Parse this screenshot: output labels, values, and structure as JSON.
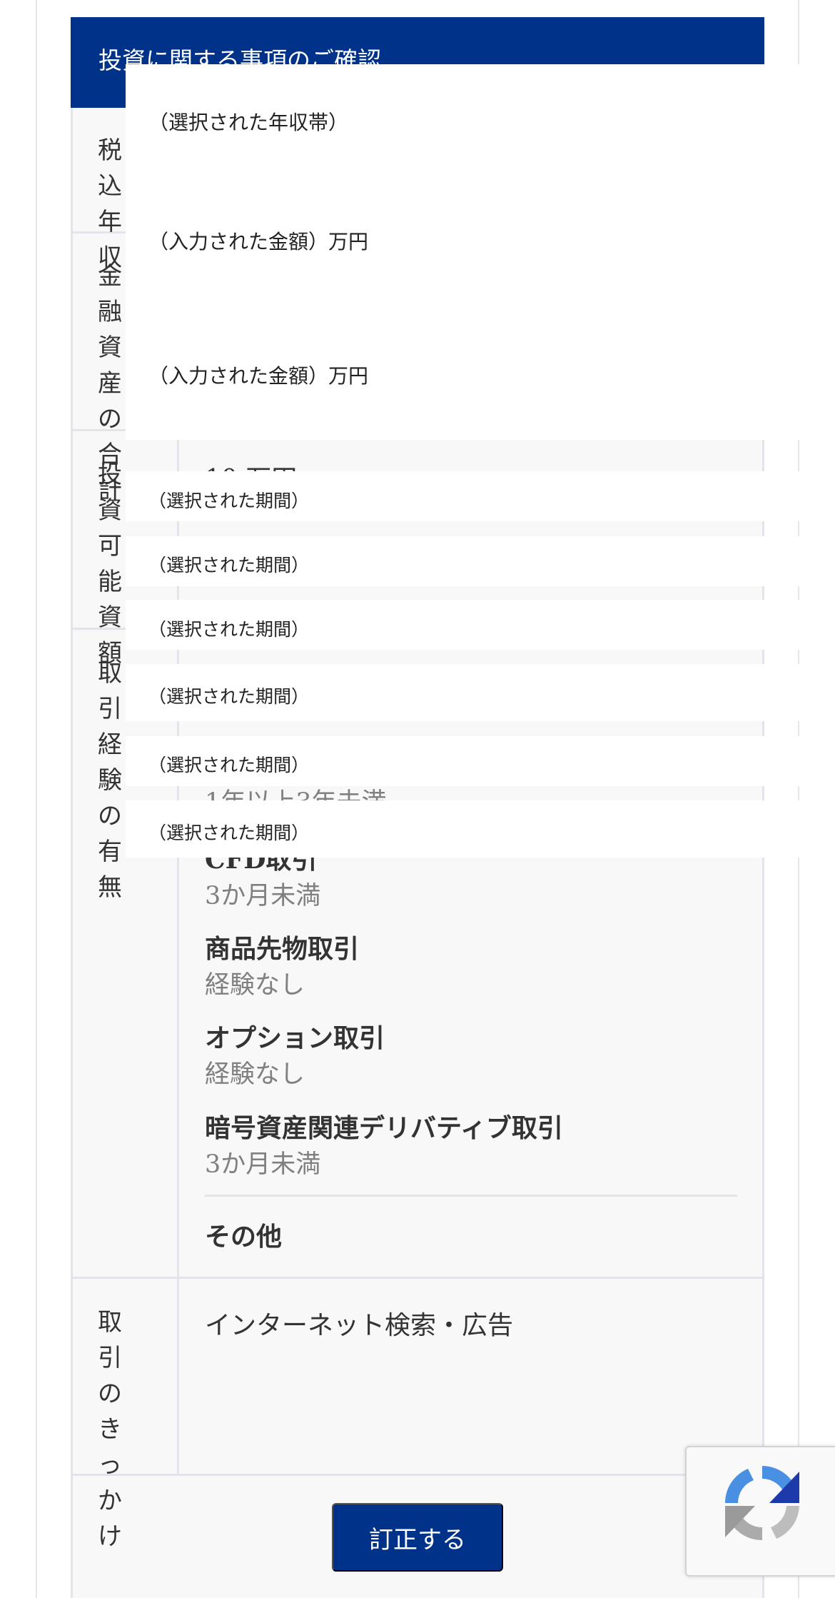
{
  "header": {
    "title": "投資に関する事項のご確認"
  },
  "rows": {
    "income_label": "税込年収",
    "assets_label": "金融資産の合計",
    "investable_label": "投資可能資額",
    "investable_value": "10 万円",
    "experience_label": "取引経験の有無",
    "trigger_label": "取引のきっかけ",
    "trigger_value": "インターネット検索・広告"
  },
  "experience": {
    "partial_line_1": "1年以上3年未満",
    "items": [
      {
        "label": "CFD取引",
        "value": "3か月未満"
      },
      {
        "label": "商品先物取引",
        "value": "経験なし"
      },
      {
        "label": "オプション取引",
        "value": "経験なし"
      },
      {
        "label": "暗号資産関連デリバティブ取引",
        "value": "3か月未満"
      }
    ],
    "other_label": "その他"
  },
  "overlay": {
    "income_placeholder": "（選択された年収帯）",
    "amount_placeholder_1": "（入力された金額）万円",
    "amount_placeholder_2": "（入力された金額）万円",
    "period_placeholders": [
      "（選択された期間）",
      "（選択された期間）",
      "（選択された期間）",
      "（選択された期間）",
      "（選択された期間）",
      "（選択された期間）"
    ]
  },
  "actions": {
    "submit_label": "訂正する"
  },
  "colors": {
    "primary": "#003289",
    "card_bg": "#f8f8f9",
    "border": "#e2e4ea",
    "muted_text": "#808080"
  },
  "icons": {
    "recaptcha": "recaptcha-logo-icon"
  }
}
